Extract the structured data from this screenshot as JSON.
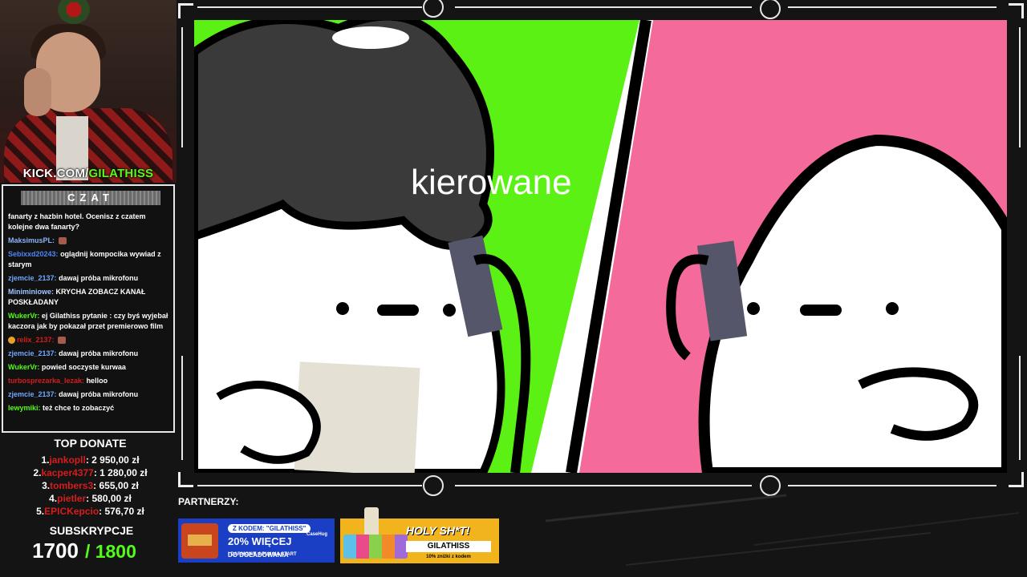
{
  "overlay": {
    "kick_url_prefix": "KICK.COM/",
    "kick_url_channel": "GILATHISS",
    "chat_title": "CZAT",
    "chat_messages": [
      {
        "user": "",
        "text": "fanarty z hazbin hotel. Ocenisz z czatem kolejne dwa fanarty?",
        "user_color": "#ffffff",
        "emote": false,
        "badge": false
      },
      {
        "user": "MaksimusPL:",
        "text": "",
        "user_color": "#8ab4f8",
        "emote": true,
        "badge": false
      },
      {
        "user": "Sebixxd20243:",
        "text": "oglądnij kompocika wywiad z starym",
        "user_color": "#4f86f7",
        "emote": false,
        "badge": false
      },
      {
        "user": "zjemcie_2137:",
        "text": "dawaj próba mikrofonu",
        "user_color": "#6fa8ff",
        "emote": false,
        "badge": false
      },
      {
        "user": "Miniminiowe:",
        "text": "KRYCHA ZOBACZ KANAŁ POSKŁADANY",
        "user_color": "#9fc5ff",
        "emote": false,
        "badge": false
      },
      {
        "user": "WukerVr:",
        "text": "ej Gilathiss pytanie : czy byś wyjebał kaczora jak by pokazał przet premierowo film",
        "user_color": "#53fc18",
        "emote": false,
        "badge": false
      },
      {
        "user": "relix_2137:",
        "text": "",
        "user_color": "#d61c1c",
        "emote": true,
        "badge": true
      },
      {
        "user": "zjemcie_2137:",
        "text": "dawaj próba mikrofonu",
        "user_color": "#6fa8ff",
        "emote": false,
        "badge": false
      },
      {
        "user": "WukerVr:",
        "text": "powied soczyste kurwaa",
        "user_color": "#53fc18",
        "emote": false,
        "badge": false
      },
      {
        "user": "turbosprezarka_lezak:",
        "text": "helloo",
        "user_color": "#d61c1c",
        "emote": false,
        "badge": false
      },
      {
        "user": "zjemcie_2137:",
        "text": "dawaj próba mikrofonu",
        "user_color": "#6fa8ff",
        "emote": false,
        "badge": false
      },
      {
        "user": "lewymiki:",
        "text": "też chce to zobaczyć",
        "user_color": "#53fc18",
        "emote": false,
        "badge": false
      }
    ],
    "top_donate_title": "TOP DONATE",
    "top_donate": [
      {
        "rank": "1.",
        "name": "jankopll",
        "amount": ": 2 950,00 zł"
      },
      {
        "rank": "2.",
        "name": "kacper4377",
        "amount": ": 1 280,00 zł"
      },
      {
        "rank": "3.",
        "name": "tombers3",
        "amount": ": 655,00 zł"
      },
      {
        "rank": "4.",
        "name": "pietler",
        "amount": ": 580,00 zł"
      },
      {
        "rank": "5.",
        "name": "EPICKepcio",
        "amount": ": 576,70 zł"
      }
    ],
    "subs_title": "SUBSKRYPCJE",
    "subs_current": "1700",
    "subs_goal": "/ 1800",
    "accent": "#53fc18",
    "donor_color": "#d61c1c"
  },
  "video": {
    "caption": "kierowane",
    "left_bg": "#5cf114",
    "right_bg": "#f46b9b"
  },
  "partners": {
    "label": "PARTNERZY:",
    "casehug": {
      "code": "Z KODEM: \"GILATHISS\"",
      "brand": "CaseHug",
      "deal": "20% WIĘCEJ",
      "deal_sub": "DO DOŁADOWANIA",
      "sub": "I DARMOWE 4 PLN NA START"
    },
    "holy": {
      "title": "HOLY SH*T!",
      "code": "GILATHISS",
      "sub": "10% zniżki z kodem"
    }
  }
}
